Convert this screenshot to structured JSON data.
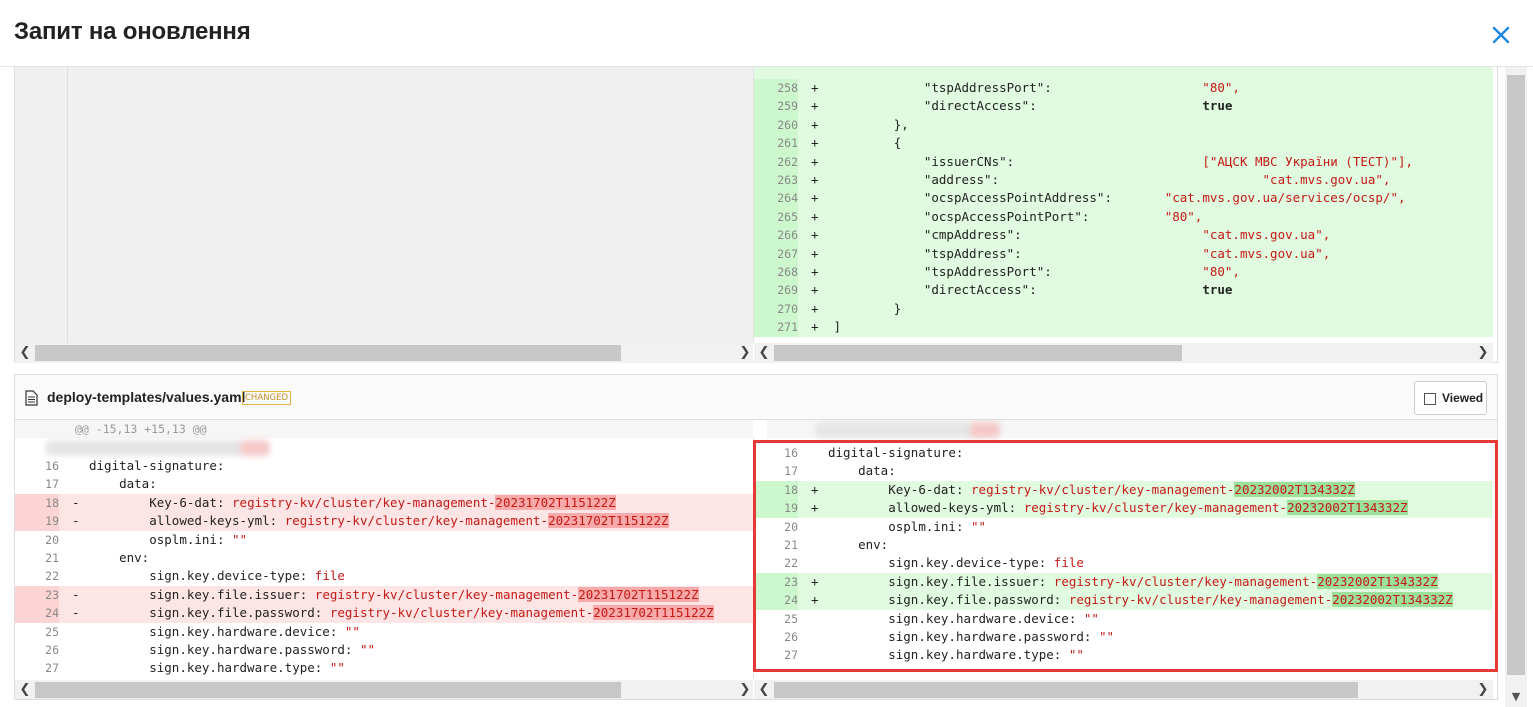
{
  "header": {
    "title": "Запит на оновлення"
  },
  "icons": {
    "close": "close-icon",
    "file": "file-icon"
  },
  "top_diff": {
    "right_lines": [
      {
        "n": "258",
        "sign": "+",
        "indent": "            ",
        "key": "\"tspAddressPort\":",
        "pad": "                    ",
        "val": "\"80\",",
        "vtype": "s"
      },
      {
        "n": "259",
        "sign": "+",
        "indent": "            ",
        "key": "\"directAccess\":",
        "pad": "                      ",
        "val": "true",
        "vtype": "b"
      },
      {
        "n": "260",
        "sign": "+",
        "indent": "        ",
        "key": "},",
        "pad": "",
        "val": "",
        "vtype": "k"
      },
      {
        "n": "261",
        "sign": "+",
        "indent": "        ",
        "key": "{",
        "pad": "",
        "val": "",
        "vtype": "k"
      },
      {
        "n": "262",
        "sign": "+",
        "indent": "            ",
        "key": "\"issuerCNs\":",
        "pad": "                         ",
        "val": "[\"АЦСК МВС України (ТЕСТ)\"],",
        "vtype": "s"
      },
      {
        "n": "263",
        "sign": "+",
        "indent": "            ",
        "key": "\"address\":",
        "pad": "                                   ",
        "val": "\"cat.mvs.gov.ua\",",
        "vtype": "s"
      },
      {
        "n": "264",
        "sign": "+",
        "indent": "            ",
        "key": "\"ocspAccessPointAddress\":",
        "pad": "       ",
        "val": "\"cat.mvs.gov.ua/services/ocsp/\",",
        "vtype": "s"
      },
      {
        "n": "265",
        "sign": "+",
        "indent": "            ",
        "key": "\"ocspAccessPointPort\":",
        "pad": "          ",
        "val": "\"80\",",
        "vtype": "s"
      },
      {
        "n": "266",
        "sign": "+",
        "indent": "            ",
        "key": "\"cmpAddress\":",
        "pad": "                        ",
        "val": "\"cat.mvs.gov.ua\",",
        "vtype": "s"
      },
      {
        "n": "267",
        "sign": "+",
        "indent": "            ",
        "key": "\"tspAddress\":",
        "pad": "                        ",
        "val": "\"cat.mvs.gov.ua\",",
        "vtype": "s"
      },
      {
        "n": "268",
        "sign": "+",
        "indent": "            ",
        "key": "\"tspAddressPort\":",
        "pad": "                    ",
        "val": "\"80\",",
        "vtype": "s"
      },
      {
        "n": "269",
        "sign": "+",
        "indent": "            ",
        "key": "\"directAccess\":",
        "pad": "                      ",
        "val": "true",
        "vtype": "b"
      },
      {
        "n": "270",
        "sign": "+",
        "indent": "        ",
        "key": "}",
        "pad": "",
        "val": "",
        "vtype": "k"
      },
      {
        "n": "271",
        "sign": "+",
        "indent": "",
        "key": "]",
        "pad": "",
        "val": "",
        "vtype": "k"
      }
    ]
  },
  "file": {
    "name": "deploy-templates/values.yaml",
    "status": "CHANGED",
    "viewed_label": "Viewed",
    "hunk": "@@ -15,13 +15,13 @@"
  },
  "bottom_diff": {
    "left_lines": [
      {
        "n": "16",
        "sign": "",
        "type": "ctx",
        "indent": "",
        "key": "digital-signature:",
        "val": "",
        "hl": ""
      },
      {
        "n": "17",
        "sign": "",
        "type": "ctx",
        "indent": "    ",
        "key": "data:",
        "val": "",
        "hl": ""
      },
      {
        "n": "18",
        "sign": "-",
        "type": "del",
        "indent": "        ",
        "key": "Key-6-dat: ",
        "val": "registry-kv/cluster/key-management-",
        "hl": "20231702T115122Z"
      },
      {
        "n": "19",
        "sign": "-",
        "type": "del",
        "indent": "        ",
        "key": "allowed-keys-yml: ",
        "val": "registry-kv/cluster/key-management-",
        "hl": "20231702T115122Z"
      },
      {
        "n": "20",
        "sign": "",
        "type": "ctx",
        "indent": "        ",
        "key": "osplm.ini: ",
        "val": "\"\"",
        "hl": ""
      },
      {
        "n": "21",
        "sign": "",
        "type": "ctx",
        "indent": "    ",
        "key": "env:",
        "val": "",
        "hl": ""
      },
      {
        "n": "22",
        "sign": "",
        "type": "ctx",
        "indent": "        ",
        "key": "sign.key.device-type: ",
        "val": "file",
        "hl": ""
      },
      {
        "n": "23",
        "sign": "-",
        "type": "del",
        "indent": "        ",
        "key": "sign.key.file.issuer: ",
        "val": "registry-kv/cluster/key-management-",
        "hl": "20231702T115122Z"
      },
      {
        "n": "24",
        "sign": "-",
        "type": "del",
        "indent": "        ",
        "key": "sign.key.file.password: ",
        "val": "registry-kv/cluster/key-management-",
        "hl": "20231702T115122Z"
      },
      {
        "n": "25",
        "sign": "",
        "type": "ctx",
        "indent": "        ",
        "key": "sign.key.hardware.device: ",
        "val": "\"\"",
        "hl": ""
      },
      {
        "n": "26",
        "sign": "",
        "type": "ctx",
        "indent": "        ",
        "key": "sign.key.hardware.password: ",
        "val": "\"\"",
        "hl": ""
      },
      {
        "n": "27",
        "sign": "",
        "type": "ctx",
        "indent": "        ",
        "key": "sign.key.hardware.type: ",
        "val": "\"\"",
        "hl": ""
      }
    ],
    "right_lines": [
      {
        "n": "16",
        "sign": "",
        "type": "ctx",
        "indent": "",
        "key": "digital-signature:",
        "val": "",
        "hl": ""
      },
      {
        "n": "17",
        "sign": "",
        "type": "ctx",
        "indent": "    ",
        "key": "data:",
        "val": "",
        "hl": ""
      },
      {
        "n": "18",
        "sign": "+",
        "type": "add",
        "indent": "        ",
        "key": "Key-6-dat: ",
        "val": "registry-kv/cluster/key-management-",
        "hl": "20232002T134332Z"
      },
      {
        "n": "19",
        "sign": "+",
        "type": "add",
        "indent": "        ",
        "key": "allowed-keys-yml: ",
        "val": "registry-kv/cluster/key-management-",
        "hl": "20232002T134332Z"
      },
      {
        "n": "20",
        "sign": "",
        "type": "ctx",
        "indent": "        ",
        "key": "osplm.ini: ",
        "val": "\"\"",
        "hl": ""
      },
      {
        "n": "21",
        "sign": "",
        "type": "ctx",
        "indent": "    ",
        "key": "env:",
        "val": "",
        "hl": ""
      },
      {
        "n": "22",
        "sign": "",
        "type": "ctx",
        "indent": "        ",
        "key": "sign.key.device-type: ",
        "val": "file",
        "hl": ""
      },
      {
        "n": "23",
        "sign": "+",
        "type": "add",
        "indent": "        ",
        "key": "sign.key.file.issuer: ",
        "val": "registry-kv/cluster/key-management-",
        "hl": "20232002T134332Z"
      },
      {
        "n": "24",
        "sign": "+",
        "type": "add",
        "indent": "        ",
        "key": "sign.key.file.password: ",
        "val": "registry-kv/cluster/key-management-",
        "hl": "20232002T134332Z"
      },
      {
        "n": "25",
        "sign": "",
        "type": "ctx",
        "indent": "        ",
        "key": "sign.key.hardware.device: ",
        "val": "\"\"",
        "hl": ""
      },
      {
        "n": "26",
        "sign": "",
        "type": "ctx",
        "indent": "        ",
        "key": "sign.key.hardware.password: ",
        "val": "\"\"",
        "hl": ""
      },
      {
        "n": "27",
        "sign": "",
        "type": "ctx",
        "indent": "        ",
        "key": "sign.key.hardware.type: ",
        "val": "\"\"",
        "hl": ""
      }
    ]
  },
  "colors": {
    "added_bg": "#e1fbe1",
    "deleted_bg": "#fde5e5",
    "string": "#c41a16",
    "accent": "#1e88e5",
    "highlight_box": "#e53935"
  }
}
